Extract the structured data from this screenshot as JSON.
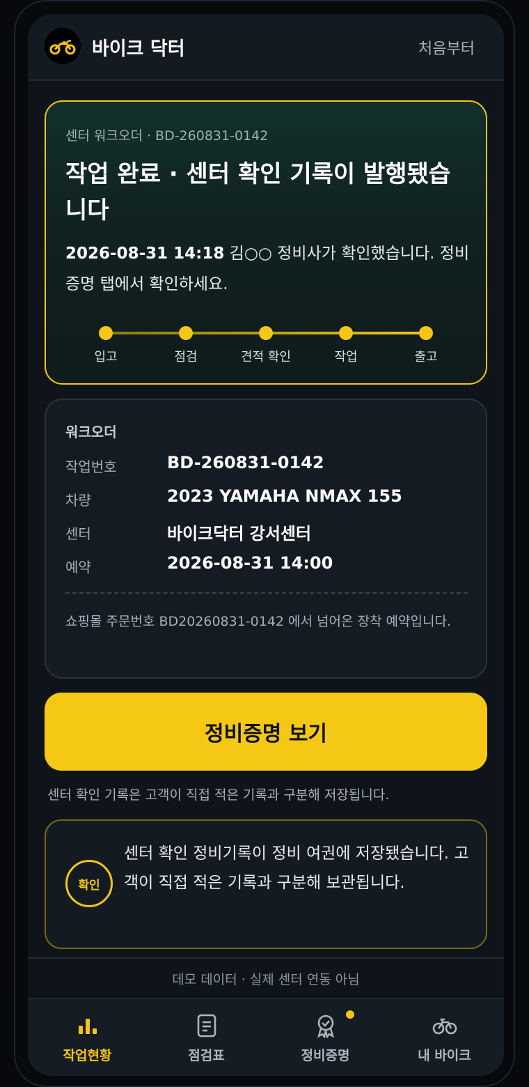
{
  "header": {
    "app_title": "바이크 닥터",
    "restart_label": "처음부터",
    "logo_icon": "motorcycle-icon"
  },
  "completion": {
    "eyebrow": "센터 워크오더 · BD-260831-0142",
    "title": "작업 완료 · 센터 확인 기록이 발행됐습니다",
    "timestamp": "2026-08-31 14:18",
    "desc_rest": " 김○○ 정비사가 확인했습니다. 정비증명 탭에서 확인하세요.",
    "steps": [
      "입고",
      "점검",
      "견적 확인",
      "작업",
      "출고"
    ]
  },
  "workorder": {
    "title": "워크오더",
    "rows": [
      {
        "key": "작업번호",
        "value": "BD-260831-0142"
      },
      {
        "key": "차량",
        "value": "2023 YAMAHA NMAX 155"
      },
      {
        "key": "센터",
        "value": "바이크닥터 강서센터"
      },
      {
        "key": "예약",
        "value": "2026-08-31 14:00"
      }
    ],
    "note": "쇼핑몰 주문번호 BD20260831-0142 에서 넘어온 장착 예약입니다."
  },
  "cta": {
    "label": "정비증명 보기",
    "caption": "센터 확인 기록은 고객이 직접 적은 기록과 구분해 저장됩니다."
  },
  "confirm": {
    "badge": "확인",
    "text": "센터 확인 정비기록이 정비 여권에 저장됐습니다. 고객이 직접 적은 기록과 구분해 보관됩니다."
  },
  "demo_notice": "데모 데이터 · 실제 센터 연동 아님",
  "tabs": [
    {
      "label": "작업현황",
      "icon": "bar-chart-icon",
      "active": true
    },
    {
      "label": "점검표",
      "icon": "document-icon",
      "active": false
    },
    {
      "label": "정비증명",
      "icon": "award-ribbon-icon",
      "active": false,
      "has_notification": true
    },
    {
      "label": "내 바이크",
      "icon": "bicycle-icon",
      "active": false
    }
  ],
  "colors": {
    "accent": "#f5c518",
    "background": "#0f141a",
    "card": "#151b22"
  }
}
